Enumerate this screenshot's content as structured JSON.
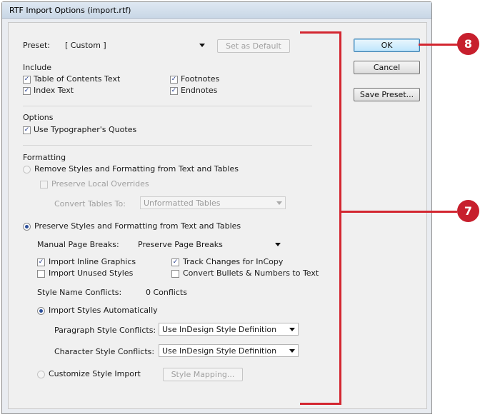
{
  "window": {
    "title": "RTF Import Options (import.rtf)"
  },
  "preset": {
    "label": "Preset:",
    "value": "[ Custom ]",
    "set_default": "Set as Default"
  },
  "buttons": {
    "ok": "OK",
    "cancel": "Cancel",
    "save_preset": "Save Preset..."
  },
  "include": {
    "heading": "Include",
    "toc": "Table of Contents Text",
    "index": "Index Text",
    "footnotes": "Footnotes",
    "endnotes": "Endnotes"
  },
  "options": {
    "heading": "Options",
    "quotes": "Use Typographer's Quotes"
  },
  "formatting": {
    "heading": "Formatting",
    "remove": "Remove Styles and Formatting from Text and Tables",
    "preserve_local": "Preserve Local Overrides",
    "convert_tables_label": "Convert Tables To:",
    "convert_tables_value": "Unformatted Tables",
    "preserve": "Preserve Styles and Formatting from Text and Tables",
    "page_breaks_label": "Manual Page Breaks:",
    "page_breaks_value": "Preserve Page Breaks",
    "inline_graphics": "Import Inline Graphics",
    "unused_styles": "Import Unused Styles",
    "track_changes": "Track Changes for InCopy",
    "convert_bullets": "Convert Bullets & Numbers to Text",
    "conflicts_label": "Style Name Conflicts:",
    "conflicts_value": "0 Conflicts",
    "import_auto": "Import Styles Automatically",
    "para_conflicts_label": "Paragraph Style Conflicts:",
    "para_conflicts_value": "Use InDesign Style Definition",
    "char_conflicts_label": "Character Style Conflicts:",
    "char_conflicts_value": "Use InDesign Style Definition",
    "customize": "Customize Style Import",
    "style_mapping": "Style Mapping..."
  },
  "callouts": {
    "ok_callout": "8",
    "options_callout": "7"
  },
  "colors": {
    "callout": "#c71f2d",
    "bracket": "#d32630"
  }
}
